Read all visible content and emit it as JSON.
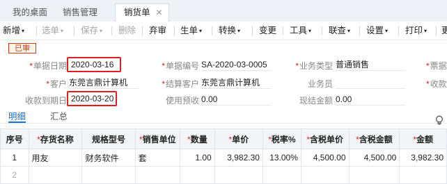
{
  "tabs": [
    {
      "label": "我的桌面"
    },
    {
      "label": "销售管理"
    },
    {
      "label": "销货单",
      "close": "✕"
    }
  ],
  "toolbar": {
    "items": [
      {
        "label": "新增",
        "caret": "▾",
        "disabled": false
      },
      {
        "label": "选单",
        "caret": "▾",
        "disabled": true
      },
      {
        "label": "保存",
        "caret": "▾",
        "disabled": true
      },
      {
        "label": "删除",
        "caret": "",
        "disabled": true
      },
      {
        "label": "弃审",
        "caret": "",
        "disabled": false
      },
      {
        "label": "生单",
        "caret": "▾",
        "disabled": false
      },
      {
        "label": "转换",
        "caret": "▾",
        "disabled": false
      },
      {
        "label": "变更",
        "caret": "",
        "disabled": false
      },
      {
        "label": "工具",
        "caret": "▾",
        "disabled": false
      },
      {
        "label": "联查",
        "caret": "▾",
        "disabled": false
      },
      {
        "label": "设置",
        "caret": "▾",
        "disabled": false
      },
      {
        "label": "打印",
        "caret": "▾",
        "disabled": false
      },
      {
        "label": "更",
        "caret": "",
        "disabled": false
      }
    ]
  },
  "stamp": "已审",
  "form": {
    "doc_date": {
      "label": "单据日期",
      "value": "2020-03-16"
    },
    "doc_no": {
      "label": "单据编号",
      "value": "SA-2020-03-0005"
    },
    "biz_type": {
      "label": "业务类型",
      "value": "普通销售"
    },
    "invoice_cut": {
      "label": "票据"
    },
    "customer": {
      "label": "客户",
      "value": "东莞言鼎计算机"
    },
    "settle_customer": {
      "label": "结算客户",
      "value": "东莞言鼎计算机"
    },
    "salesperson": {
      "label": "业务员",
      "value": ""
    },
    "receipt_cut": {
      "label": "收款"
    },
    "due_date": {
      "label": "收款到期日",
      "value": "2020-03-20"
    },
    "prepay": {
      "label": "使用预收",
      "value": "0.00"
    },
    "cash": {
      "label": "现结金额",
      "value": "0.00"
    }
  },
  "subtabs": [
    {
      "label": "明细"
    },
    {
      "label": "汇总"
    }
  ],
  "grid": {
    "columns": [
      {
        "label": "序号",
        "required": ""
      },
      {
        "label": "存货名称",
        "required": "*"
      },
      {
        "label": "规格型号",
        "required": ""
      },
      {
        "label": "销售单位",
        "required": "*"
      },
      {
        "label": "数量",
        "required": "*"
      },
      {
        "label": "单价",
        "required": "*"
      },
      {
        "label": "税率%",
        "required": "*"
      },
      {
        "label": "含税单价",
        "required": "*"
      },
      {
        "label": "含税金额",
        "required": "*"
      },
      {
        "label": "金额",
        "required": "*"
      }
    ],
    "rows": [
      {
        "cells": [
          "1",
          "用友",
          "财务软件",
          "套",
          "1.00",
          "3,982.30",
          "13.00%",
          "4,500.00",
          "4,500.00",
          "3,982.30"
        ]
      },
      {
        "cells": [
          "2",
          "",
          "",
          "",
          "",
          "",
          "",
          "",
          "",
          ""
        ]
      }
    ]
  }
}
